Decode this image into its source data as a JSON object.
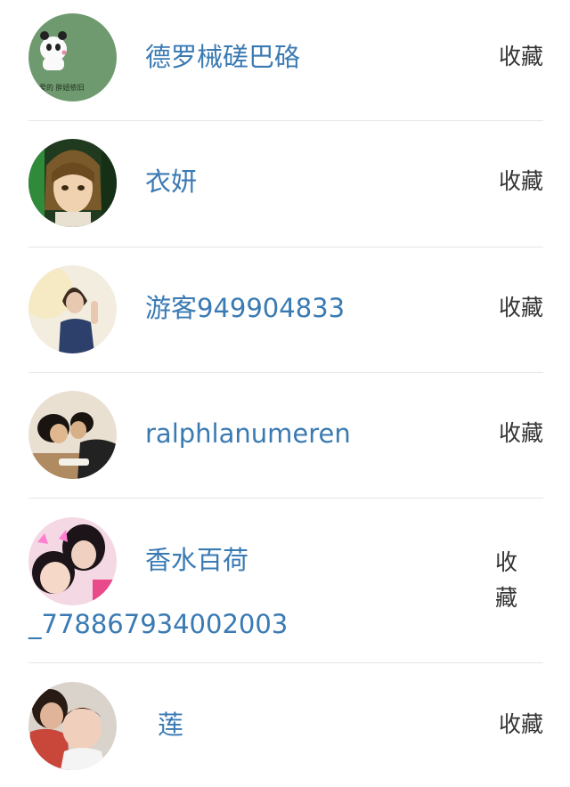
{
  "users": [
    {
      "name": "德罗械磋巴硌",
      "action": "收藏",
      "avatar": "panda-avatar",
      "avatar_caption": "爱的  胖妞依旧"
    },
    {
      "name": "衣妍",
      "action": "收藏",
      "avatar": "anime-avatar"
    },
    {
      "name": "游客949904833",
      "action": "收藏",
      "avatar": "woman-avatar"
    },
    {
      "name": "ralphlanumeren",
      "action": "收藏",
      "avatar": "couple-avatar"
    },
    {
      "name_line1": "香水百荷",
      "name_line2": "_778867934002003",
      "action": "收藏",
      "avatar": "kids-avatar"
    },
    {
      "name": "莲",
      "action": "收藏",
      "avatar": "family-avatar"
    }
  ],
  "colors": {
    "name": "#3a7ab3",
    "action": "#333333",
    "divider": "#e6e6e6"
  }
}
